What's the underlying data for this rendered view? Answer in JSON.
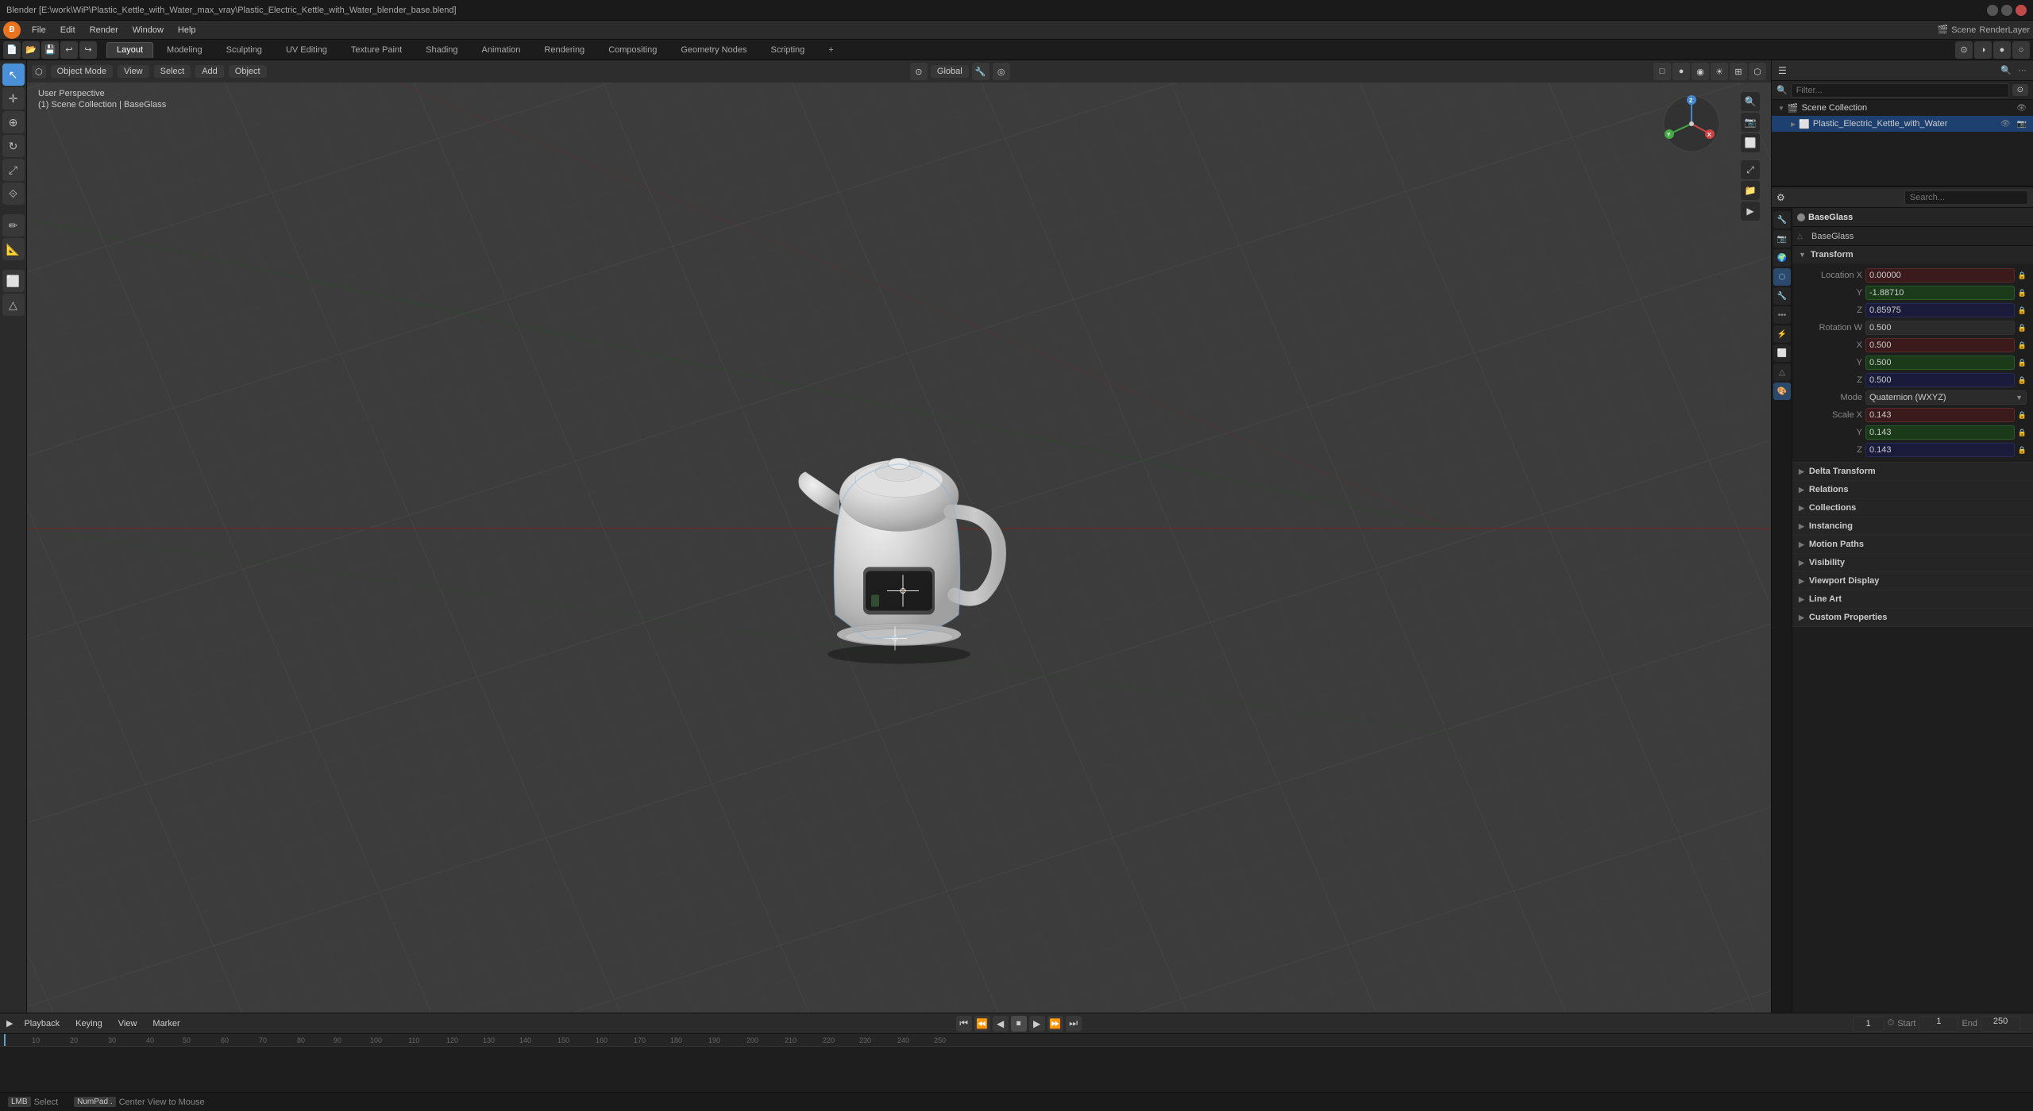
{
  "title": "Blender [E:\\work\\WiP\\Plastic_Kettle_with_Water_max_vray\\Plastic_Electric_Kettle_with_Water_blender_base.blend]",
  "titlebar": {
    "text": "Blender [E:\\work\\WiP\\Plastic_Kettle_with_Water_max_vray\\Plastic_Electric_Kettle_with_Water_blender_base.blend]"
  },
  "menubar": {
    "items": [
      "File",
      "Edit",
      "Render",
      "Window",
      "Help"
    ]
  },
  "workspace_tabs": [
    {
      "label": "Layout",
      "active": true
    },
    {
      "label": "Modeling"
    },
    {
      "label": "Sculpting"
    },
    {
      "label": "UV Editing"
    },
    {
      "label": "Texture Paint"
    },
    {
      "label": "Shading"
    },
    {
      "label": "Animation"
    },
    {
      "label": "Rendering"
    },
    {
      "label": "Compositing"
    },
    {
      "label": "Geometry Nodes"
    },
    {
      "label": "Scripting"
    },
    {
      "label": "+"
    }
  ],
  "viewport": {
    "mode": "Object Mode",
    "view_label": "View",
    "select_label": "Select",
    "add_label": "Add",
    "object_label": "Object",
    "transform_space": "Global",
    "info_line1": "User Perspective",
    "info_line2": "(1) Scene Collection | BaseGlass"
  },
  "outliner": {
    "title": "Scene Collection",
    "search_placeholder": "Filter...",
    "items": [
      {
        "name": "Plastic_Electric_Kettle_with_Water",
        "icon": "▶",
        "indent": 0,
        "selected": true
      }
    ]
  },
  "properties": {
    "object_name": "BaseGlass",
    "mesh_name": "BaseGlass",
    "sections": {
      "transform": {
        "label": "Transform",
        "location": {
          "x": "0.00000",
          "y": "-1.88710",
          "z": "0.85975"
        },
        "rotation_w": "0.500",
        "rotation_x": "0.500",
        "rotation_y": "0.500",
        "rotation_z": "0.500",
        "mode": "Quaternion (WXYZ)",
        "scale_x": "0.143",
        "scale_y": "0.143",
        "scale_z": "0.143"
      },
      "delta_transform": {
        "label": "Delta Transform",
        "collapsed": true
      },
      "relations": {
        "label": "Relations",
        "collapsed": true
      },
      "collections": {
        "label": "Collections",
        "collapsed": true
      },
      "instancing": {
        "label": "Instancing",
        "collapsed": true
      },
      "motion_paths": {
        "label": "Motion Paths",
        "collapsed": true
      },
      "visibility": {
        "label": "Visibility",
        "collapsed": true
      },
      "viewport_display": {
        "label": "Viewport Display",
        "collapsed": true
      },
      "line_art": {
        "label": "Line Art",
        "collapsed": true
      },
      "custom_properties": {
        "label": "Custom Properties",
        "collapsed": true
      }
    }
  },
  "sidebar_icons": [
    {
      "icon": "🔵",
      "title": "Tool",
      "active": false
    },
    {
      "icon": "📷",
      "title": "Scene",
      "active": false
    },
    {
      "icon": "🌍",
      "title": "World",
      "active": false
    },
    {
      "icon": "⬡",
      "title": "Object",
      "active": true
    },
    {
      "icon": "△",
      "title": "Modifier",
      "active": false
    },
    {
      "icon": "◎",
      "title": "Particles",
      "active": false
    },
    {
      "icon": "⚡",
      "title": "Physics",
      "active": false
    },
    {
      "icon": "⬜",
      "title": "Constraints",
      "active": false
    },
    {
      "icon": "🔷",
      "title": "Data",
      "active": false
    },
    {
      "icon": "🎨",
      "title": "Material",
      "active": false
    }
  ],
  "timeline": {
    "mode": "Timeline",
    "playback_label": "Playback",
    "keying_label": "Keying",
    "view_label": "View",
    "marker_label": "Marker",
    "start": "1",
    "end": "250",
    "current_frame": "1",
    "frame_marks": [
      10,
      20,
      30,
      40,
      50,
      60,
      70,
      80,
      90,
      100,
      110,
      120,
      130,
      140,
      150,
      160,
      170,
      180,
      190,
      200,
      210,
      220,
      230,
      240,
      250
    ]
  },
  "statusbar": {
    "select_label": "Select",
    "center_view_label": "Center View to Mouse"
  },
  "colors": {
    "active_tab": "#3a3a3a",
    "accent_blue": "#4a90d9",
    "orange_keyframe": "#e0a030",
    "playhead_color": "#5a9fd4"
  }
}
